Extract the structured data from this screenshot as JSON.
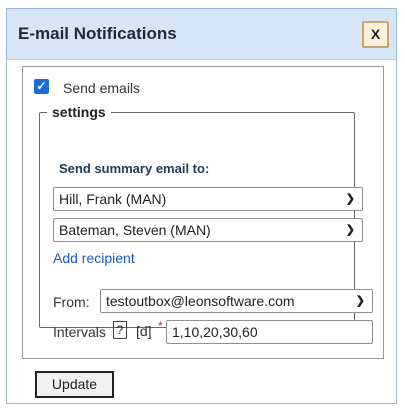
{
  "dialog": {
    "title": "E-mail Notifications",
    "close_label": "X"
  },
  "send_emails": {
    "label": "Send emails",
    "checked": true
  },
  "settings": {
    "legend": "settings",
    "summary_label": "Send summary email to:",
    "recipients": [
      "Hill, Frank (MAN)",
      "Bateman, Steven (MAN)"
    ],
    "add_recipient": "Add recipient",
    "from_label": "From:",
    "from_value": "testoutbox@leonsoftware.com",
    "intervals_label": "Intervals",
    "help_label": "?",
    "unit_label": "[d]",
    "required_mark": "*",
    "intervals_value": "1,10,20,30,60"
  },
  "update_label": "Update",
  "colors": {
    "titlebar": "#d6e6f7",
    "checkbox": "#1a6fd1",
    "link": "#1a56c4",
    "required": "#c62828"
  }
}
